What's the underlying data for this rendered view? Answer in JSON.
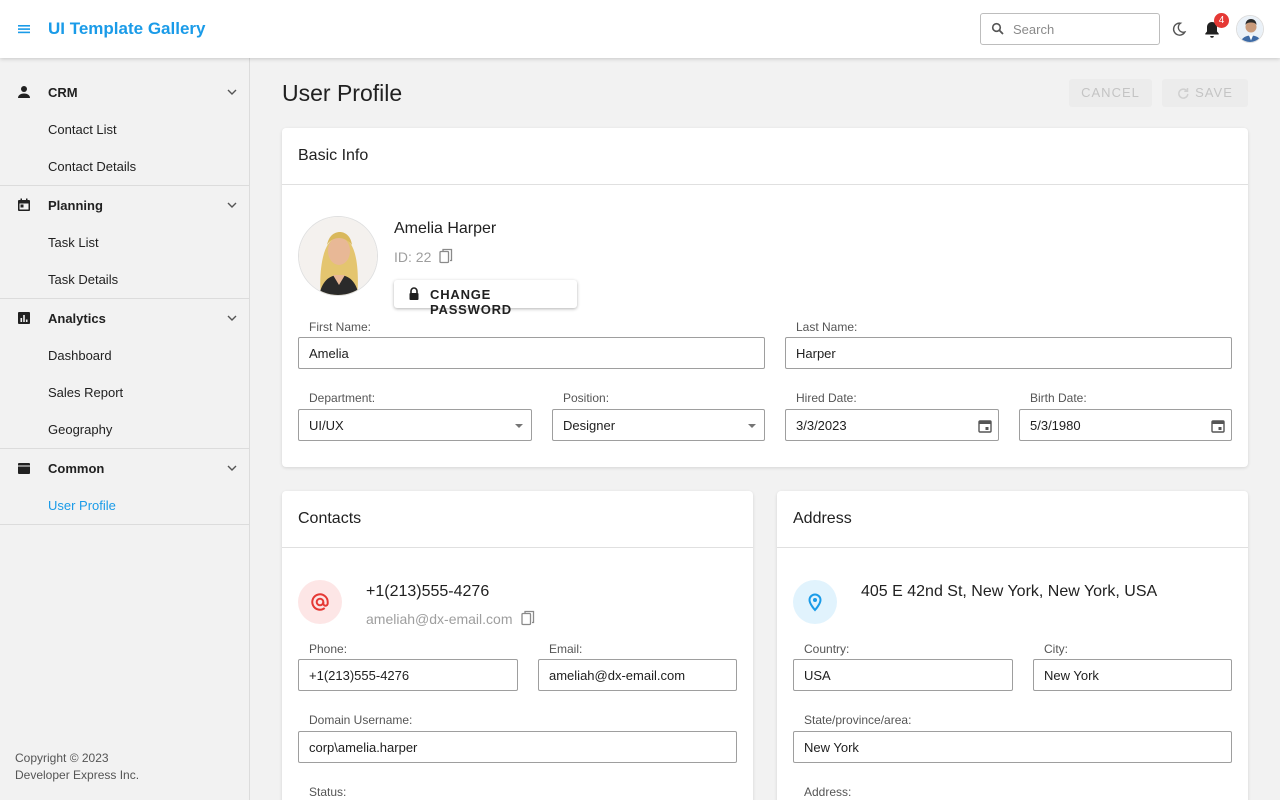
{
  "header": {
    "app_title": "UI Template Gallery",
    "search_placeholder": "Search",
    "notifications_count": "4",
    "icons": [
      "menu-icon",
      "search-icon",
      "moon-icon",
      "bell-icon",
      "avatar"
    ]
  },
  "sidebar": {
    "groups": [
      {
        "label": "CRM",
        "icon": "person-icon",
        "items": [
          "Contact List",
          "Contact Details"
        ]
      },
      {
        "label": "Planning",
        "icon": "calendar-icon",
        "items": [
          "Task List",
          "Task Details"
        ]
      },
      {
        "label": "Analytics",
        "icon": "chart-icon",
        "items": [
          "Dashboard",
          "Sales Report",
          "Geography"
        ]
      },
      {
        "label": "Common",
        "icon": "folder-icon",
        "items": [
          "User Profile"
        ]
      }
    ],
    "active_item": "User Profile",
    "footer_line1": "Copyright © 2023",
    "footer_line2": "Developer Express Inc."
  },
  "page": {
    "title": "User Profile",
    "cancel_label": "CANCEL",
    "save_label": "SAVE"
  },
  "basic_info": {
    "title": "Basic Info",
    "name": "Amelia Harper",
    "id_text": "ID: 22",
    "change_password_label": "CHANGE PASSWORD",
    "fields": {
      "first_name": {
        "label": "First Name:",
        "value": "Amelia"
      },
      "last_name": {
        "label": "Last Name:",
        "value": "Harper"
      },
      "department": {
        "label": "Department:",
        "value": "UI/UX"
      },
      "position": {
        "label": "Position:",
        "value": "Designer"
      },
      "hired_date": {
        "label": "Hired Date:",
        "value": "3/3/2023"
      },
      "birth_date": {
        "label": "Birth Date:",
        "value": "5/3/1980"
      }
    }
  },
  "contacts": {
    "title": "Contacts",
    "phone_display": "+1(213)555-4276",
    "email_display": "ameliah@dx-email.com",
    "fields": {
      "phone": {
        "label": "Phone:",
        "value": "+1(213)555-4276"
      },
      "email": {
        "label": "Email:",
        "value": "ameliah@dx-email.com"
      },
      "domain_username": {
        "label": "Domain Username:",
        "value": "corp\\amelia.harper"
      },
      "status": {
        "label": "Status:"
      }
    }
  },
  "address": {
    "title": "Address",
    "full_address": "405 E 42nd St, New York, New York, USA",
    "fields": {
      "country": {
        "label": "Country:",
        "value": "USA"
      },
      "city": {
        "label": "City:",
        "value": "New York"
      },
      "state": {
        "label": "State/province/area:",
        "value": "New York"
      },
      "address": {
        "label": "Address:"
      }
    }
  },
  "colors": {
    "accent": "#1a9be8",
    "badge": "#e53935",
    "contact_icon_bg": "#fde6e6",
    "contact_icon": "#e53935",
    "address_icon_bg": "#e1f3fd",
    "address_icon": "#1a9be8"
  }
}
